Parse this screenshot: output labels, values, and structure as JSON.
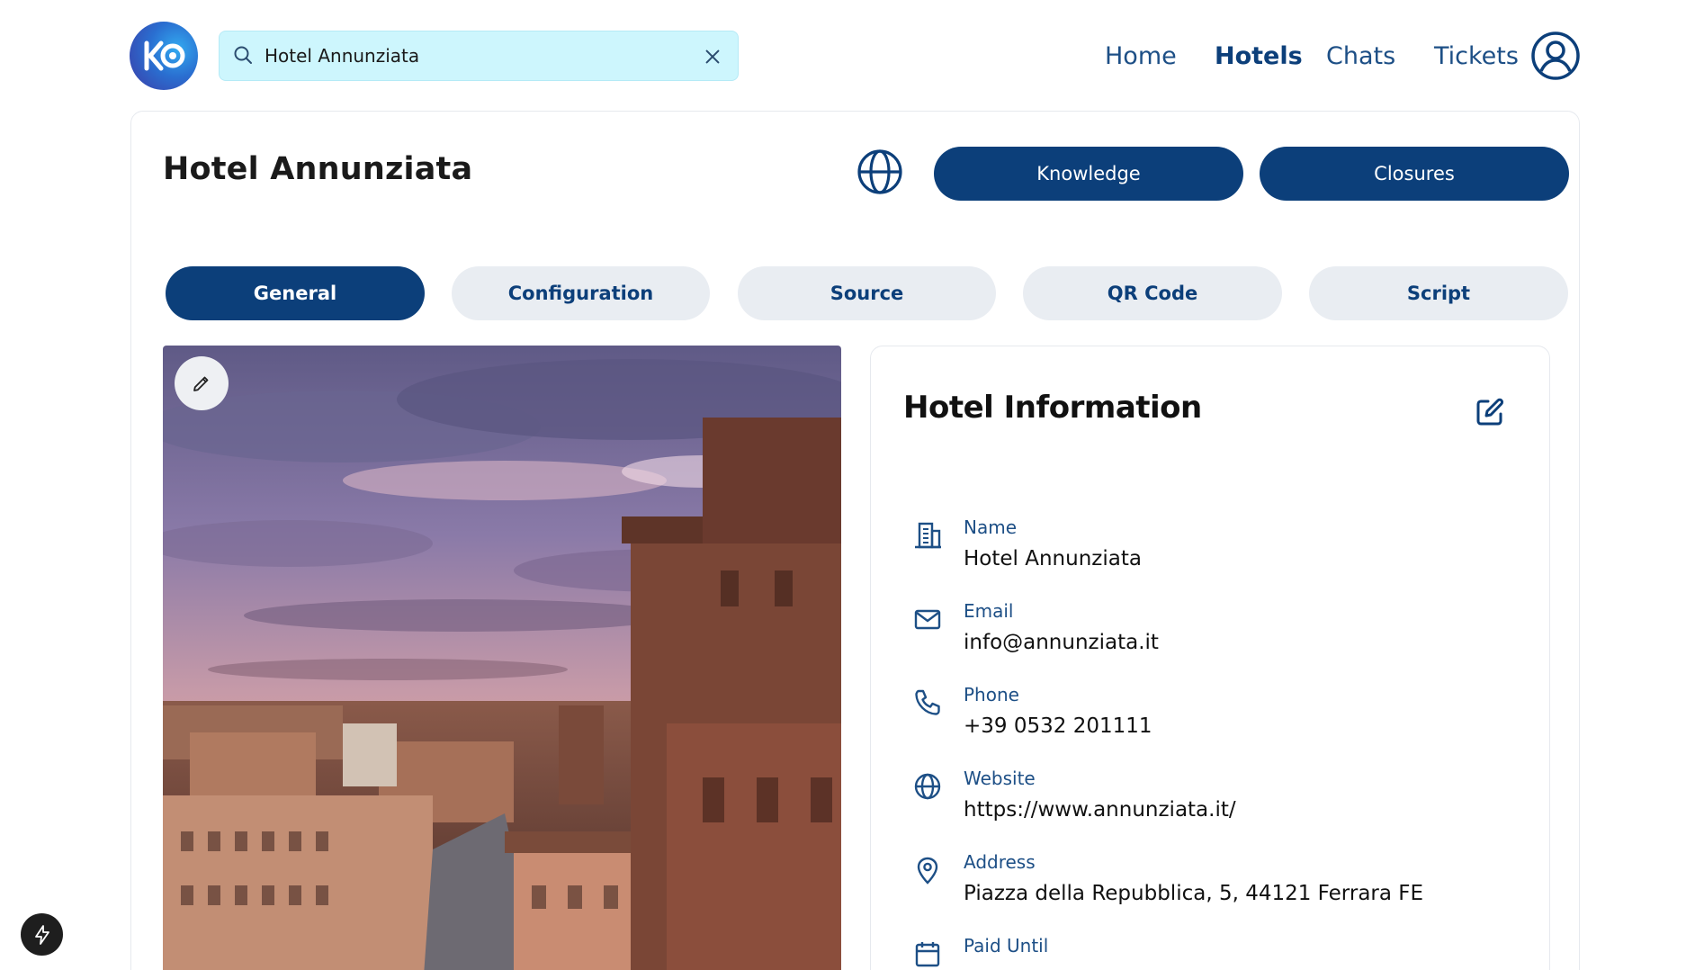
{
  "search": {
    "value": "Hotel Annunziata",
    "icon": "search-icon",
    "clear_icon": "close-icon"
  },
  "nav": {
    "items": [
      {
        "label": "Home",
        "active": false
      },
      {
        "label": "Hotels",
        "active": true
      },
      {
        "label": "Chats",
        "active": false
      },
      {
        "label": "Tickets",
        "active": false
      }
    ],
    "profile_icon": "user-circle-icon"
  },
  "header": {
    "title": "Hotel Annunziata",
    "globe_icon": "globe-icon",
    "buttons": {
      "knowledge": "Knowledge",
      "closures": "Closures"
    }
  },
  "tabs": [
    {
      "label": "General",
      "active": true
    },
    {
      "label": "Configuration",
      "active": false
    },
    {
      "label": "Source",
      "active": false
    },
    {
      "label": "QR Code",
      "active": false
    },
    {
      "label": "Script",
      "active": false
    }
  ],
  "photo": {
    "edit_icon": "pencil-icon"
  },
  "info": {
    "title": "Hotel Information",
    "edit_icon": "edit-square-icon",
    "fields": [
      {
        "label": "Name",
        "value": "Hotel Annunziata",
        "icon": "building-icon"
      },
      {
        "label": "Email",
        "value": "info@annunziata.it",
        "icon": "mail-icon"
      },
      {
        "label": "Phone",
        "value": "+39 0532 201111",
        "icon": "phone-icon"
      },
      {
        "label": "Website",
        "value": "https://www.annunziata.it/",
        "icon": "globe-icon"
      },
      {
        "label": "Address",
        "value": "Piazza della Repubblica, 5, 44121 Ferrara FE",
        "icon": "map-pin-icon"
      },
      {
        "label": "Paid Until",
        "value": "",
        "icon": "calendar-icon"
      }
    ]
  },
  "colors": {
    "primary": "#0c3f7a",
    "tab_inactive": "#e9edf2",
    "search_bg": "#cdf6fd",
    "link": "#1d4f86"
  }
}
